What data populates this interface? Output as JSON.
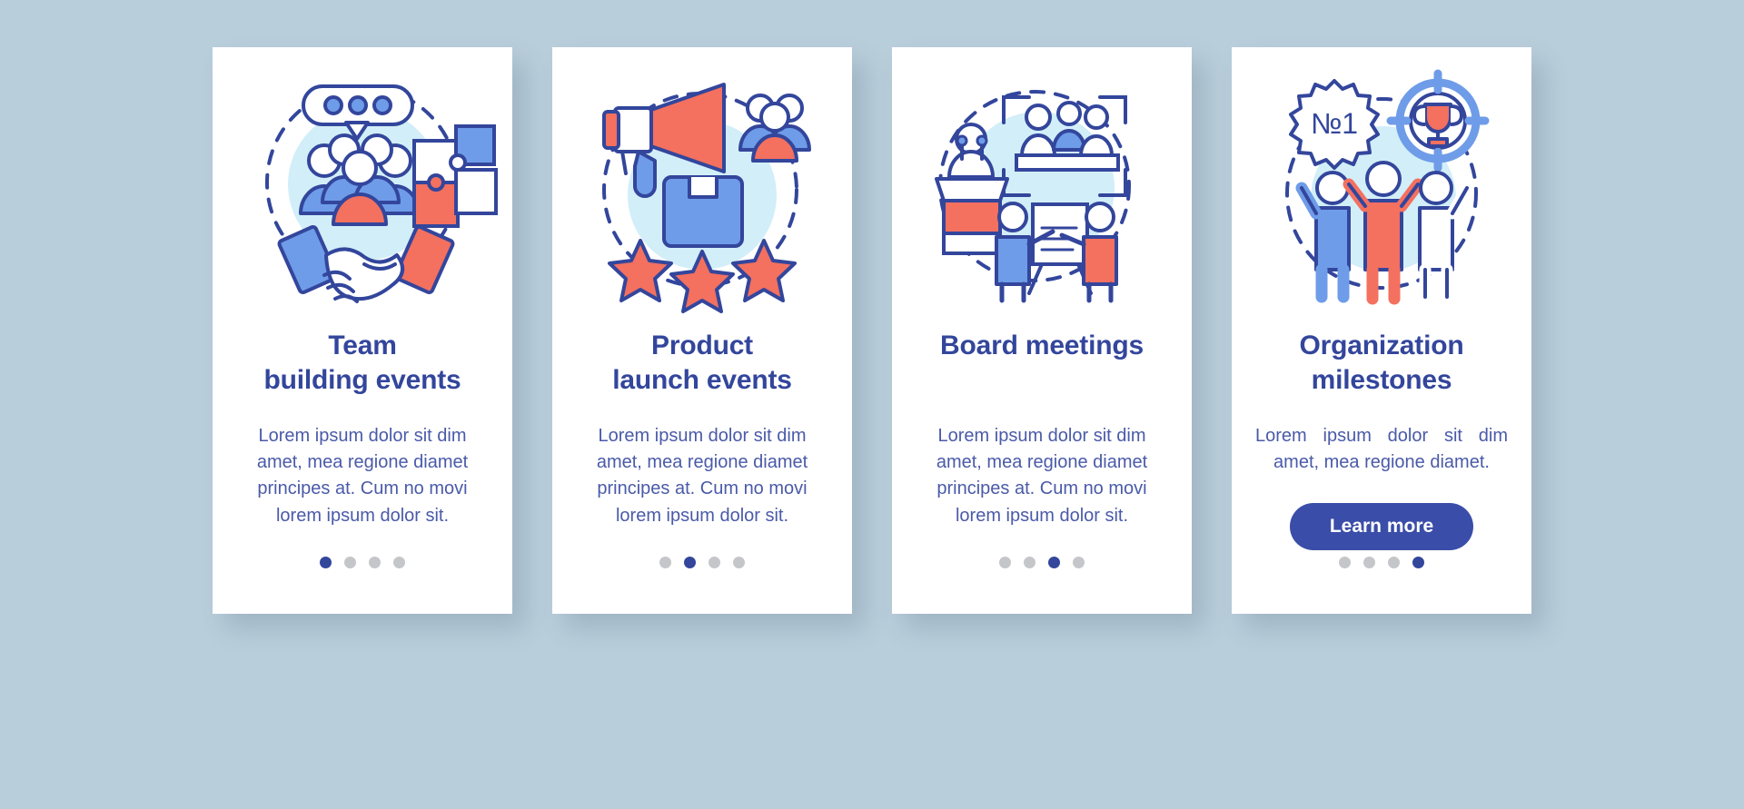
{
  "theme": {
    "background": "#b9cedb",
    "card_background": "#ffffff",
    "title_color": "#33469c",
    "body_color": "#4a5aa8",
    "accent_blue": "#33469c",
    "light_blue": "#6e9ce8",
    "coral": "#f4705f",
    "pale_circle": "#d2eef8",
    "dot_inactive": "#c4c6c9"
  },
  "cards": [
    {
      "id": "team-building-events",
      "illustration": "handshake-team-puzzle-icon",
      "title_line1": "Team",
      "title_line2": "building events",
      "body": "Lorem ipsum dolor sit dim amet, mea regione diamet principes at. Cum no movi lorem ipsum dolor sit.",
      "cta": null,
      "dots": {
        "count": 4,
        "active": 1
      }
    },
    {
      "id": "product-launch-events",
      "illustration": "megaphone-box-stars-icon",
      "title_line1": "Product",
      "title_line2": "launch events",
      "body": "Lorem ipsum dolor sit dim amet, mea regione diamet principes at. Cum no movi lorem ipsum dolor sit.",
      "cta": null,
      "dots": {
        "count": 4,
        "active": 2
      }
    },
    {
      "id": "board-meetings",
      "illustration": "podium-presentation-icon",
      "title_line1": "Board meetings",
      "title_line2": "",
      "body": "Lorem ipsum dolor sit dim amet, mea regione diamet principes at. Cum no movi lorem ipsum dolor sit.",
      "cta": null,
      "dots": {
        "count": 4,
        "active": 3
      }
    },
    {
      "id": "organization-milestones",
      "illustration": "trophy-target-badge-team-icon",
      "title_line1": "Organization",
      "title_line2": "milestones",
      "body": "Lorem ipsum dolor sit dim amet, mea regione diamet.",
      "cta": "Learn more",
      "dots": {
        "count": 4,
        "active": 4
      }
    }
  ],
  "badge_text": "№1"
}
